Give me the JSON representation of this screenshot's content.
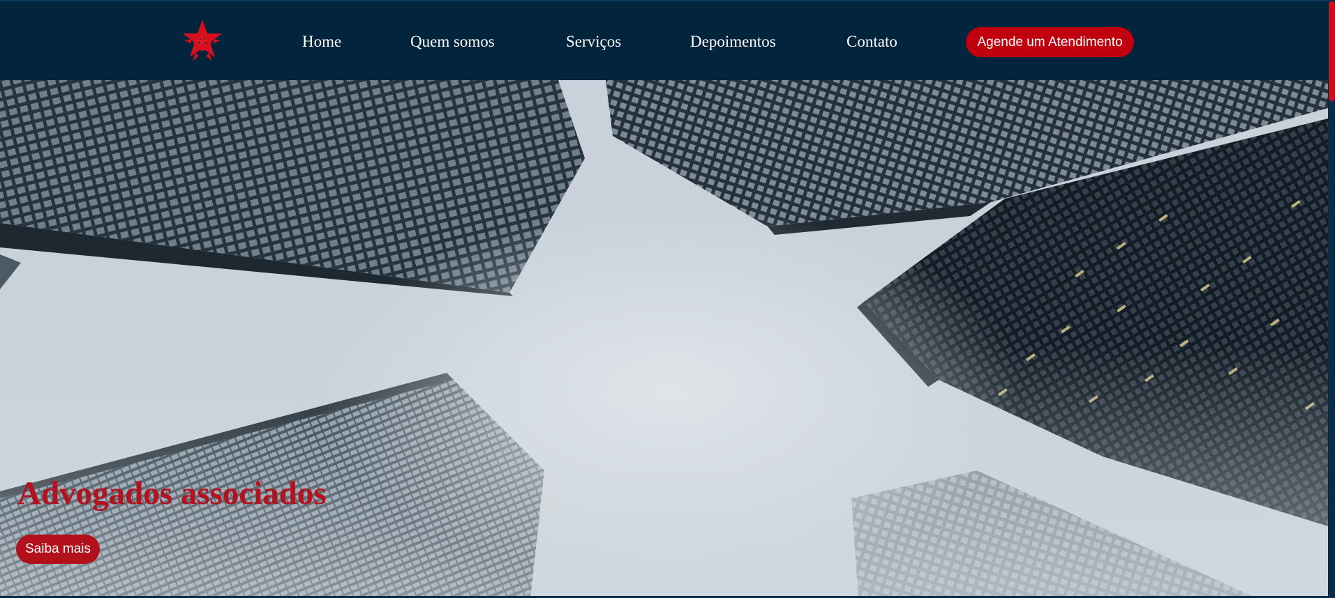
{
  "header": {
    "logo_icon": "red-star-emblem-icon",
    "nav": {
      "home": "Home",
      "about": "Quem somos",
      "services": "Serviços",
      "testimonials": "Depoimentos",
      "contact": "Contato"
    },
    "cta_label": "Agende um Atendimento"
  },
  "hero": {
    "title": "Advogados associados",
    "button_label": "Saiba mais"
  },
  "colors": {
    "header_bg": "#03243d",
    "accent_red": "#c0000f",
    "hero_title_red": "#b3121f"
  }
}
